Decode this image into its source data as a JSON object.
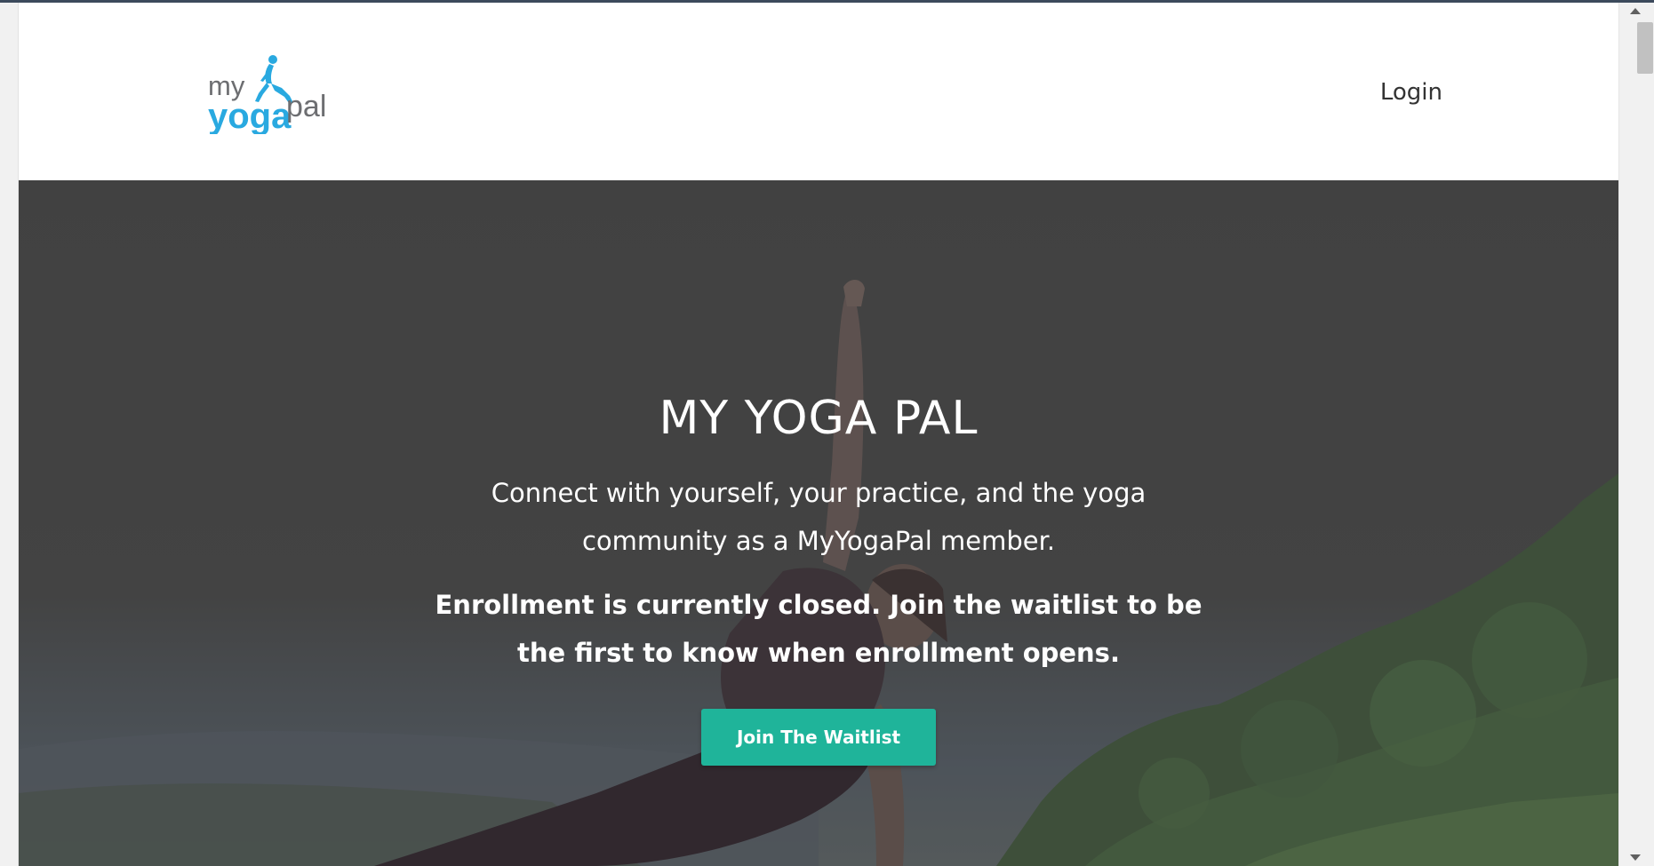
{
  "header": {
    "logo": {
      "word_my": "my",
      "word_yoga": "yoga",
      "word_pal": "pal",
      "accent_color": "#29a9e0",
      "text_color": "#6d6e71"
    },
    "login_label": "Login"
  },
  "hero": {
    "title": "MY YOGA PAL",
    "subtitle": "Connect with yourself, your practice, and the yoga community as a MyYogaPal member.",
    "notice": "Enrollment is currently closed. Join the waitlist to be the first to know when enrollment opens.",
    "cta_label": "Join The Waitlist",
    "cta_color": "#1fb49a",
    "background_icon": "yoga-pose-photo"
  },
  "scrollbar": {
    "up_icon": "scroll-up-arrow-icon",
    "down_icon": "scroll-down-arrow-icon"
  }
}
